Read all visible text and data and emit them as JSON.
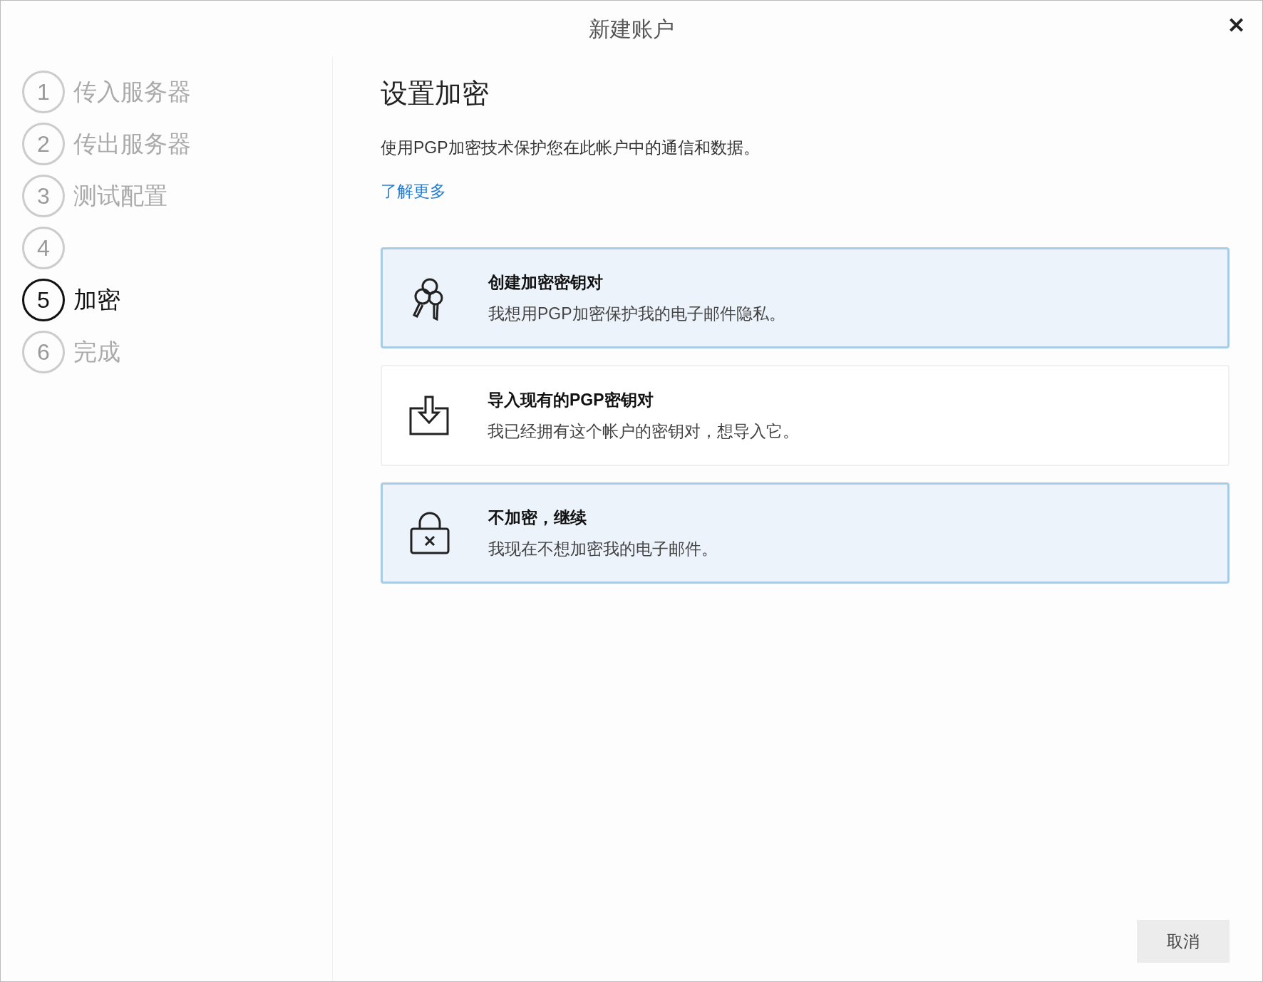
{
  "window": {
    "title": "新建账户",
    "close": "✕"
  },
  "steps": [
    {
      "number": "1",
      "label": "传入服务器",
      "selected": false
    },
    {
      "number": "2",
      "label": "传出服务器",
      "selected": false
    },
    {
      "number": "3",
      "label": "测试配置",
      "selected": false
    },
    {
      "number": "4",
      "selected": false
    },
    {
      "number": "5",
      "label": "加密",
      "selected": true
    },
    {
      "number": "6",
      "label": "完成",
      "selected": false
    }
  ],
  "heading": "设置加密",
  "description": "使用PGP加密技术保护您在此帐户中的通信和数据。",
  "link": "了解更多",
  "options": [
    {
      "kind": "keys",
      "title": "创建加密密钥对",
      "subtitle": "我想用PGP加密保护我的电子邮件隐私。",
      "selected": true
    },
    {
      "kind": "import",
      "title": "导入现有的PGP密钥对",
      "subtitle": "我已经拥有这个帐户的密钥对，想导入它。",
      "selected": false
    },
    {
      "kind": "nolock",
      "title": "不加密，继续",
      "subtitle": "我现在不想加密我的电子邮件。",
      "selected": true
    }
  ],
  "buttons": [
    {
      "label": "取消"
    }
  ]
}
